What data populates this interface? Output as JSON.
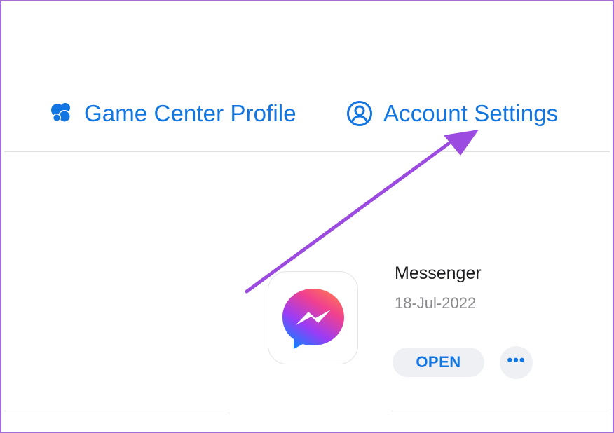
{
  "header": {
    "game_center_label": "Game Center Profile",
    "account_settings_label": "Account Settings"
  },
  "app": {
    "name": "Messenger",
    "date": "18-Jul-2022",
    "open_label": "OPEN",
    "more_label": "•••"
  },
  "icons": {
    "game_center": "game-center-icon",
    "account": "person-circle-icon",
    "app": "messenger-icon",
    "annotation": "arrow-annotation"
  },
  "colors": {
    "accent": "#1276e2",
    "annotation": "#9b4be0",
    "frame": "#a070d8"
  }
}
